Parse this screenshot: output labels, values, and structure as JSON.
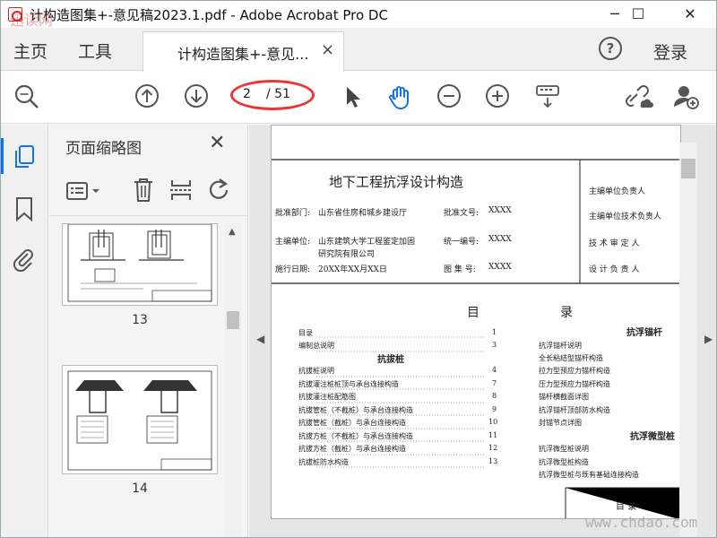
{
  "window": {
    "title": "计构造图集+-意见稿2023.1.pdf - Adobe Acrobat Pro DC",
    "minimize": "─",
    "maximize": "☐",
    "close": "✕"
  },
  "tabs": {
    "home": "主页",
    "tools": "工具",
    "document_tab": "计构造图集+-意见...",
    "document_tab_close": "×",
    "help": "?",
    "login": "登录"
  },
  "toolbar": {
    "current_page": "2",
    "total_pages": "/ 51"
  },
  "thumbnails": {
    "panel_title": "页面缩略图",
    "close": "✕",
    "items": [
      {
        "label": "13"
      },
      {
        "label": "14"
      }
    ]
  },
  "document": {
    "title": "地下工程抗浮设计构造",
    "approval_dept_label": "批准部门:",
    "approval_dept": "山东省住房和城乡建设厅",
    "approval_no_label": "批准文号:",
    "approval_no": "XXXX",
    "editor_unit_label": "主编单位:",
    "editor_unit_line1": "山东建筑大学工程鉴定加固",
    "editor_unit_line2": "研究院有限公司",
    "unified_no_label": "统一编号:",
    "unified_no": "XXXX",
    "effective_label": "施行日期:",
    "effective": "20XX年XX月XX日",
    "atlas_no_label": "图 集 号:",
    "atlas_no": "XXXX",
    "right_column": [
      "主编单位负责人",
      "主编单位技术负责人",
      "技 术 审 定 人",
      "设 计 负 责 人"
    ],
    "toc_heading_left": "目",
    "toc_heading_right": "录",
    "toc_left": [
      {
        "text": "目录",
        "page": "1"
      },
      {
        "text": "编制总说明",
        "page": "3"
      }
    ],
    "section_pile": "抗拔桩",
    "toc_pile": [
      {
        "text": "抗拔桩说明",
        "page": "4"
      },
      {
        "text": "抗拔灌注桩桩顶与承台连接构造",
        "page": "7"
      },
      {
        "text": "抗拔灌注桩配筋图",
        "page": "8"
      },
      {
        "text": "抗拔管桩（不截桩）与承台连接构造",
        "page": "9"
      },
      {
        "text": "抗拔管桩（截桩）与承台连接构造",
        "page": "10"
      },
      {
        "text": "抗拔方桩（不截桩）与承台连接构造",
        "page": "11"
      },
      {
        "text": "抗拔方桩（截桩）与承台连接构造",
        "page": "12"
      },
      {
        "text": "抗拔桩防水构造",
        "page": "13"
      }
    ],
    "section_anchor": "抗浮锚杆",
    "toc_anchor": [
      {
        "text": "抗浮锚杆说明"
      },
      {
        "text": "全长粘结型锚杆构造"
      },
      {
        "text": "拉力型预应力锚杆构造"
      },
      {
        "text": "压力型预应力锚杆构造"
      },
      {
        "text": "锚杆横截面详图"
      },
      {
        "text": "抗浮锚杆顶部防水构造"
      },
      {
        "text": "封锚节点详图"
      }
    ],
    "section_micropile": "抗浮微型桩",
    "toc_micropile": [
      {
        "text": "抗浮微型桩说明"
      },
      {
        "text": "抗浮微型桩构造"
      },
      {
        "text": "抗浮微型桩与既有基础连接构造"
      }
    ],
    "footer_box": "目   录"
  },
  "watermarks": {
    "top_left": "迅读网",
    "bottom_right": "www.chdao.com"
  }
}
